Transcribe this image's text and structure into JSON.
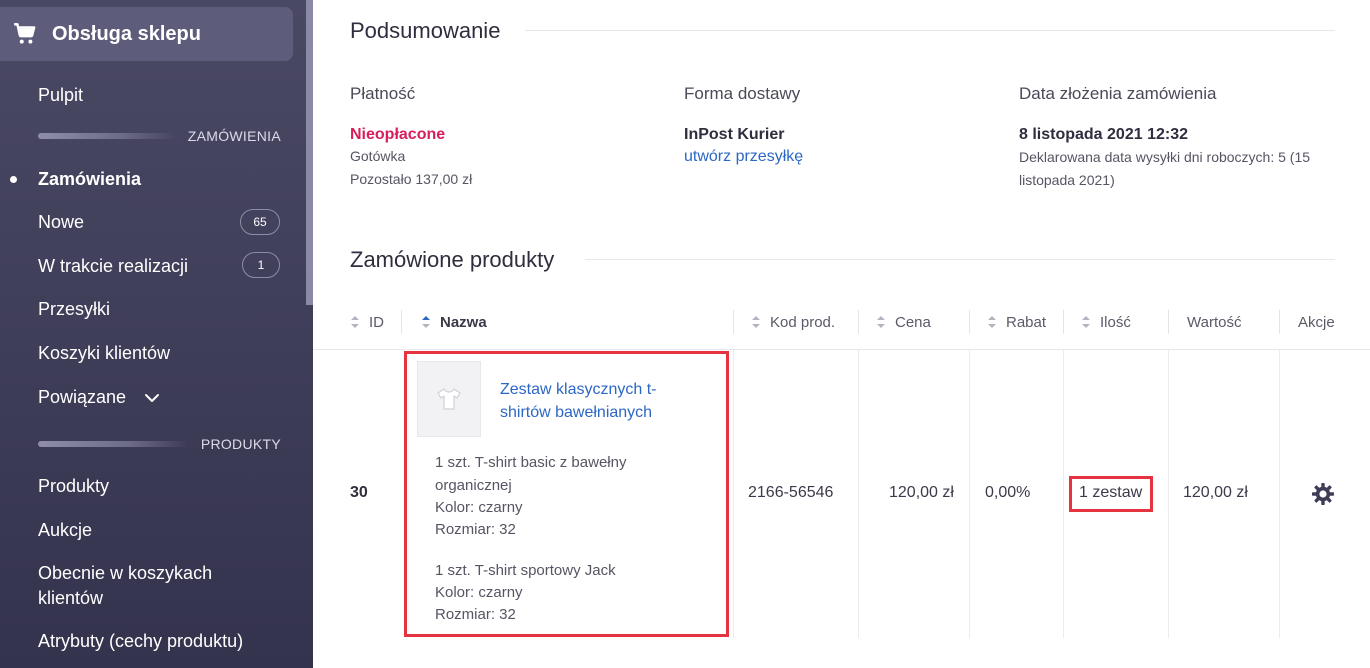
{
  "sidebar": {
    "title": "Obsługa sklepu",
    "items": {
      "pulpit": "Pulpit",
      "zamowienia": "Zamówienia",
      "nowe": "Nowe",
      "nowe_count": "65",
      "w_trakcie": "W trakcie realizacji",
      "w_trakcie_count": "1",
      "przesylki": "Przesyłki",
      "koszyki": "Koszyki klientów",
      "powiazane": "Powiązane",
      "produkty": "Produkty",
      "aukcje": "Aukcje",
      "obecnie_line1": "Obecnie w koszykach",
      "obecnie_line2": "klientów",
      "atrybuty": "Atrybuty (cechy produktu)"
    },
    "sections": {
      "zamowienia": "ZAMÓWIENIA",
      "produkty": "PRODUKTY"
    }
  },
  "summary": {
    "title": "Podsumowanie",
    "payment": {
      "label": "Płatność",
      "status": "Nieopłacone",
      "method": "Gotówka",
      "remaining": "Pozostało 137,00 zł"
    },
    "delivery": {
      "label": "Forma dostawy",
      "carrier": "InPost Kurier",
      "link": "utwórz przesyłkę"
    },
    "date": {
      "label": "Data złożenia zamówienia",
      "value": "8 listopada 2021 12:32",
      "declared_line1": "Deklarowana data wysyłki dni roboczych: 5 (15",
      "declared_line2": "listopada 2021)"
    }
  },
  "products": {
    "title": "Zamówione produkty",
    "columns": {
      "id": "ID",
      "name": "Nazwa",
      "code": "Kod prod.",
      "price": "Cena",
      "discount": "Rabat",
      "qty": "Ilość",
      "value": "Wartość",
      "actions": "Akcje"
    },
    "row": {
      "id": "30",
      "name_line1": "Zestaw klasycznych t-",
      "name_line2": "shirtów bawełnianych",
      "item1_line1": "1 szt. T-shirt basic z bawełny",
      "item1_line2": "organicznej",
      "item1_color": "Kolor: czarny",
      "item1_size": "Rozmiar: 32",
      "item2_line1": "1 szt. T-shirt sportowy Jack",
      "item2_color": "Kolor: czarny",
      "item2_size": "Rozmiar: 32",
      "code": "2166-56546",
      "price": "120,00 zł",
      "discount": "0,00%",
      "qty": "1 zestaw",
      "value": "120,00 zł"
    }
  },
  "colors": {
    "sidebar_bg": "#3e3d58",
    "unpaid": "#d81e5b",
    "link": "#2c67c6",
    "highlight": "#e53340"
  }
}
